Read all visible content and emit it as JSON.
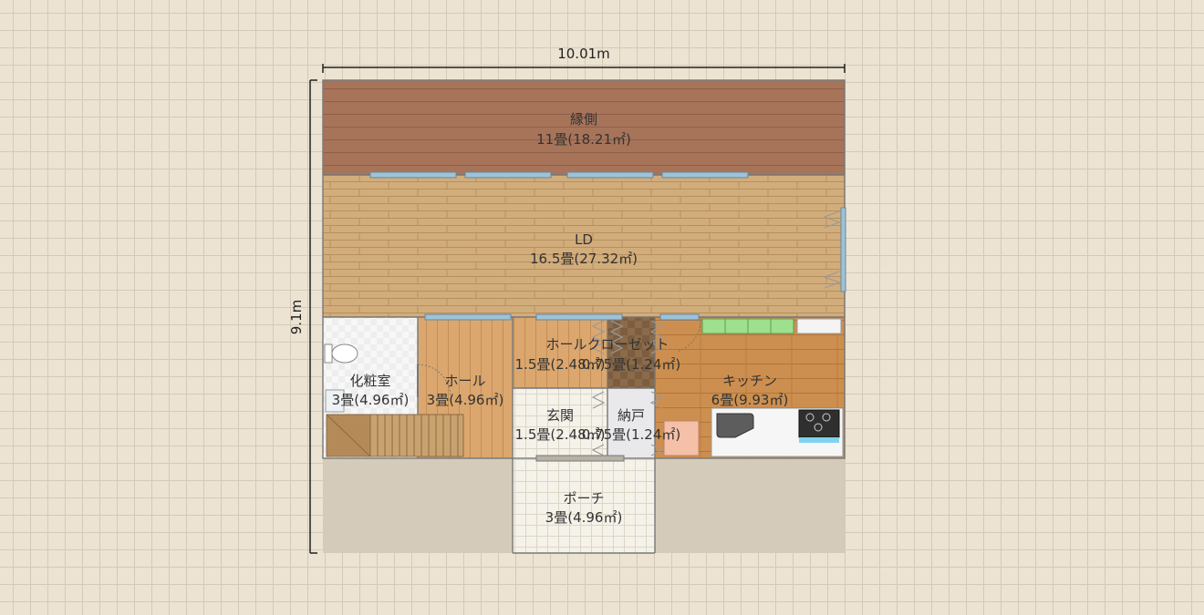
{
  "dimensions": {
    "width": "10.01m",
    "height": "9.1m"
  },
  "rooms": [
    {
      "id": "engawa",
      "name": "縁側",
      "area": "11畳(18.21㎡)"
    },
    {
      "id": "ld",
      "name": "LD",
      "area": "16.5畳(27.32㎡)"
    },
    {
      "id": "keshoshitsu",
      "name": "化粧室",
      "area": "3畳(4.96㎡)"
    },
    {
      "id": "hall",
      "name": "ホール",
      "area": "3畳(4.96㎡)"
    },
    {
      "id": "hall-closet",
      "name": "ホールクローゼット",
      "area": "1.5畳(2.48㎡)",
      "area2": "0.75畳(1.24㎡)"
    },
    {
      "id": "kitchen",
      "name": "キッチン",
      "area": "6畳(9.93㎡)"
    },
    {
      "id": "genkan",
      "name": "玄関",
      "area": "1.5畳(2.48㎡)"
    },
    {
      "id": "nando",
      "name": "納戸",
      "area": "0.75畳(1.24㎡)"
    },
    {
      "id": "porch",
      "name": "ポーチ",
      "area": "3畳(4.96㎡)"
    }
  ],
  "colors": {
    "engawa_floor": "#a7745a",
    "ld_floor": "#d2ad7c",
    "hall_floor": "#dba76e",
    "kitchen_floor": "#cd8f4f",
    "closet_floor": "#8b6b4a",
    "tile_floor": "#f5f2ea",
    "outer_ground": "#d5cbbb",
    "window": "#9ec3d8",
    "counter_green": "#9de08e"
  }
}
